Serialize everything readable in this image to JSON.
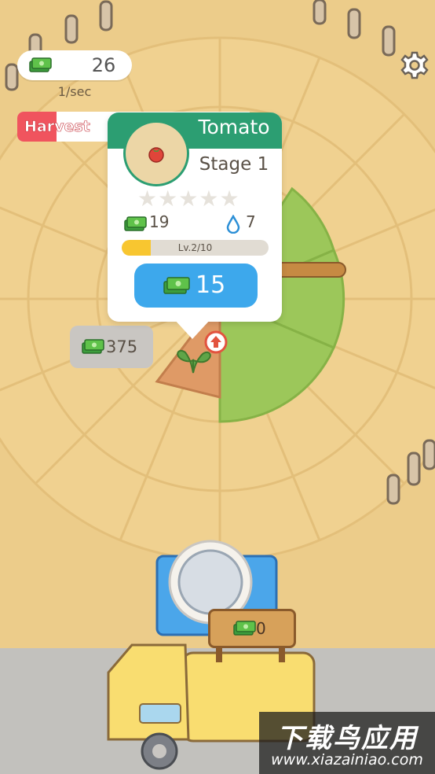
{
  "hud": {
    "money": "26",
    "rate": "1/sec",
    "harvest_label": "Harvest",
    "harvest_progress": 0.17,
    "money_icon": "cash-icon",
    "settings_icon": "gear-icon"
  },
  "popup": {
    "crop_name": "Tomato",
    "stage": "Stage 1",
    "crop_icon": "tomato-icon",
    "stars_total": 5,
    "stars_filled": 0,
    "income": "19",
    "water": "7",
    "level_label": "Lv.2/10",
    "level_progress": 0.2,
    "upgrade_cost": "15"
  },
  "plot": {
    "price": "375",
    "upgrade_badge_icon": "arrow-up-icon"
  },
  "truck": {
    "cargo_value": "0"
  },
  "watermark": {
    "title": "下载鸟应用",
    "url": "www.xiazainiao.com"
  },
  "colors": {
    "ground": "#eccc8a",
    "grass": "#9cc75a",
    "popup_header": "#2c9e72",
    "upgrade_button": "#3da8ec",
    "harvest_fill": "#f0545e",
    "level_fill": "#f8c630"
  }
}
